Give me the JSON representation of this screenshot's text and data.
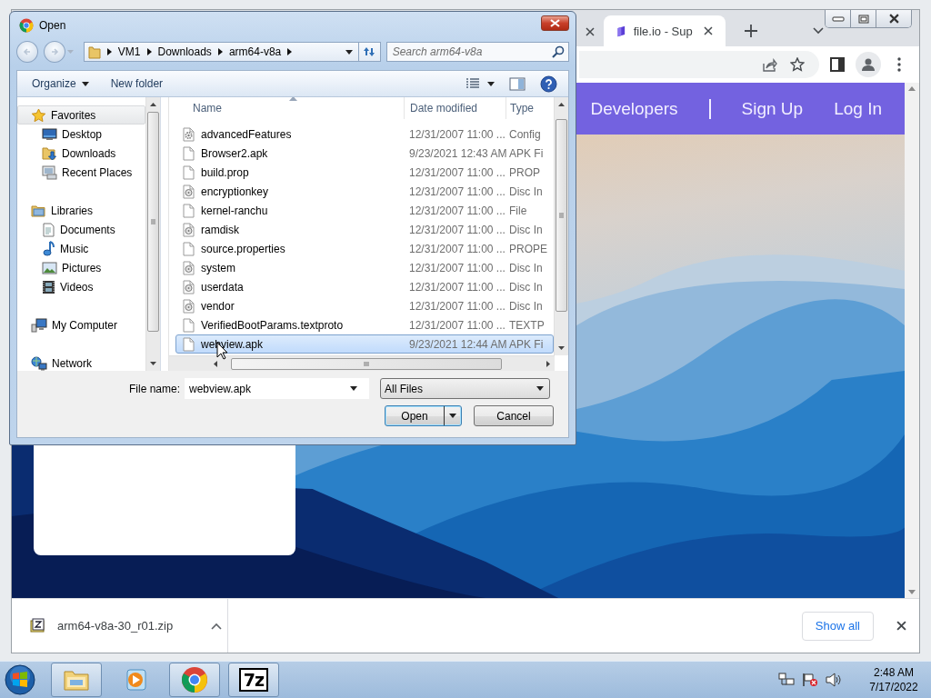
{
  "browser": {
    "tabs": [
      {
        "selected": false
      },
      {
        "title": "file.io - Sup",
        "selected": true
      }
    ],
    "site_nav": [
      {
        "kind": "link",
        "label": "Developers"
      },
      {
        "kind": "divider"
      },
      {
        "kind": "link",
        "label": "Sign Up"
      },
      {
        "kind": "link",
        "label": "Log In"
      }
    ],
    "downloads": [
      {
        "file": "arm64-v8a-30_r01.zip"
      }
    ],
    "show_all": "Show all"
  },
  "file_dialog": {
    "title": "Open",
    "path": [
      "VM1",
      "Downloads",
      "arm64-v8a"
    ],
    "search": {
      "placeholder": "Search arm64-v8a"
    },
    "toolbar": [
      {
        "kind": "menu",
        "label": "Organize"
      },
      {
        "kind": "button",
        "label": "New folder"
      }
    ],
    "nav": [
      {
        "label": "Favorites",
        "selected": true,
        "children": [
          {
            "label": "Desktop",
            "selected": false
          },
          {
            "label": "Downloads",
            "selected": false
          },
          {
            "label": "Recent Places",
            "selected": false
          }
        ]
      },
      {
        "label": "Libraries",
        "selected": false,
        "children": [
          {
            "label": "Documents",
            "selected": false
          },
          {
            "label": "Music",
            "selected": false
          },
          {
            "label": "Pictures",
            "selected": false
          },
          {
            "label": "Videos",
            "selected": false
          }
        ]
      },
      {
        "label": "My Computer",
        "selected": false
      },
      {
        "label": "Network",
        "selected": false
      }
    ],
    "columns": [
      "Name",
      "Date modified",
      "Type"
    ],
    "files": [
      {
        "name": "advancedFeatures",
        "date": "12/31/2007 11:00 ...",
        "type": "Config",
        "kind": "config",
        "selected": false
      },
      {
        "name": "Browser2.apk",
        "date": "9/23/2021 12:43 AM",
        "type": "APK Fi",
        "kind": "file",
        "selected": false
      },
      {
        "name": "build.prop",
        "date": "12/31/2007 11:00 ...",
        "type": "PROP",
        "kind": "file",
        "selected": false
      },
      {
        "name": "encryptionkey",
        "date": "12/31/2007 11:00 ...",
        "type": "Disc In",
        "kind": "disc",
        "selected": false
      },
      {
        "name": "kernel-ranchu",
        "date": "12/31/2007 11:00 ...",
        "type": "File",
        "kind": "file",
        "selected": false
      },
      {
        "name": "ramdisk",
        "date": "12/31/2007 11:00 ...",
        "type": "Disc In",
        "kind": "disc",
        "selected": false
      },
      {
        "name": "source.properties",
        "date": "12/31/2007 11:00 ...",
        "type": "PROPE",
        "kind": "file",
        "selected": false
      },
      {
        "name": "system",
        "date": "12/31/2007 11:00 ...",
        "type": "Disc In",
        "kind": "disc",
        "selected": false
      },
      {
        "name": "userdata",
        "date": "12/31/2007 11:00 ...",
        "type": "Disc In",
        "kind": "disc",
        "selected": false
      },
      {
        "name": "vendor",
        "date": "12/31/2007 11:00 ...",
        "type": "Disc In",
        "kind": "disc",
        "selected": false
      },
      {
        "name": "VerifiedBootParams.textproto",
        "date": "12/31/2007 11:00 ...",
        "type": "TEXTP",
        "kind": "file",
        "selected": false
      },
      {
        "name": "webview.apk",
        "date": "9/23/2021 12:44 AM",
        "type": "APK Fi",
        "kind": "file",
        "selected": true
      }
    ],
    "file_name": {
      "label": "File name:",
      "value": "webview.apk"
    },
    "filter": {
      "value": "All Files"
    },
    "buttons": [
      {
        "label": "Open",
        "kind": "split",
        "default": true
      },
      {
        "label": "Cancel",
        "kind": "plain",
        "default": false
      }
    ]
  },
  "taskbar": {
    "items": [
      {
        "kind": "explorer",
        "running": true
      },
      {
        "kind": "media",
        "running": false
      },
      {
        "kind": "browser",
        "running": true
      },
      {
        "kind": "archiver",
        "glyph": "7z",
        "running": true
      }
    ],
    "time": "2:48 AM",
    "date": "7/17/2022"
  }
}
